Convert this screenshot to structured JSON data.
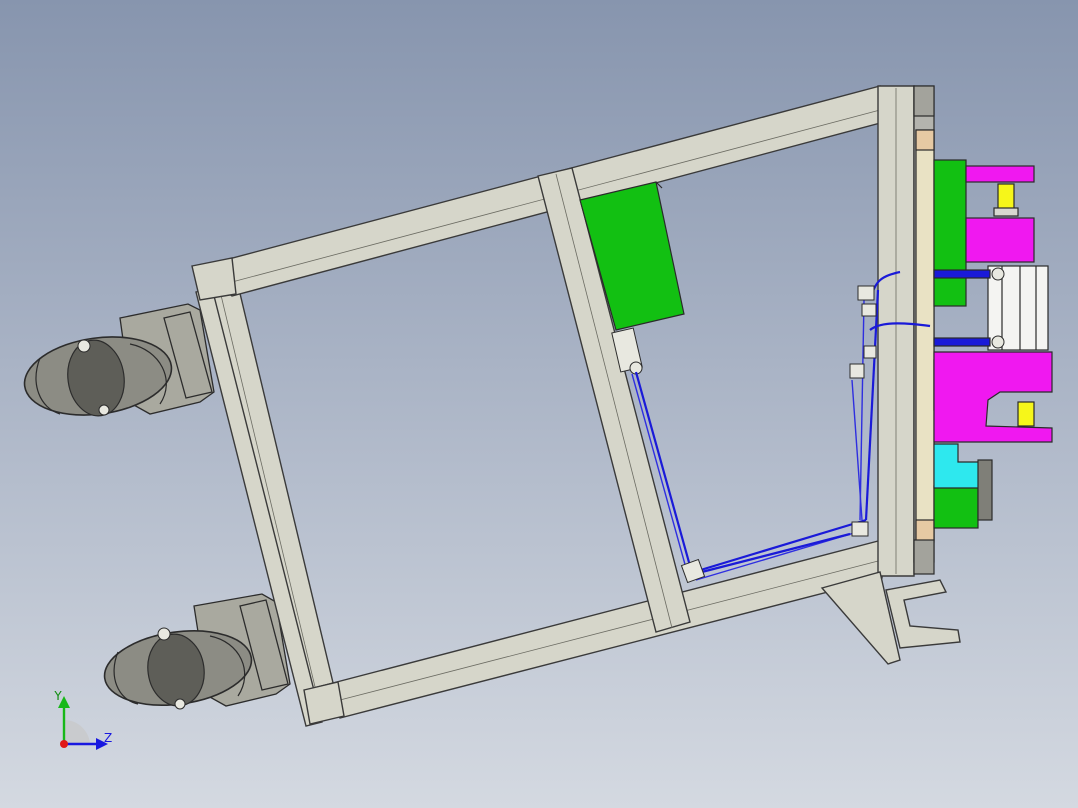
{
  "viewport": {
    "background_top": "#8795ae",
    "background_bottom": "#d4d9e1"
  },
  "colors": {
    "frame": "#d6d6ca",
    "valve_block": "#12c012",
    "fixture_magenta": "#f018f0",
    "fixture_cyan": "#2ee8ee",
    "cylinder_yellow": "#f6f61a",
    "plate_tan": "#e9e2c4",
    "hose_blue": "#1a1ad8",
    "axis_x": "#e01818",
    "axis_y": "#18b818",
    "axis_z": "#1818e0"
  },
  "triad": {
    "y_label": "Y",
    "z_label": "Z"
  },
  "icons": [
    "coordinate-triad-icon"
  ]
}
